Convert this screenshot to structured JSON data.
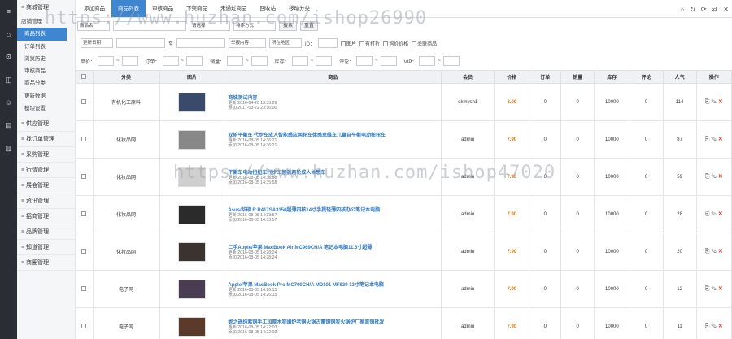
{
  "rail": [
    {
      "icon": "≡",
      "name": "menu-icon"
    },
    {
      "icon": "⌂",
      "name": "home-icon"
    },
    {
      "icon": "⚙",
      "name": "gear-icon"
    },
    {
      "icon": "◫",
      "name": "panel-icon"
    },
    {
      "icon": "☺",
      "name": "user-icon"
    },
    {
      "icon": "▤",
      "name": "list-icon"
    },
    {
      "icon": "▥",
      "name": "chart-icon"
    }
  ],
  "sidebar": {
    "top_group": "商城管理",
    "sub_top": "店铺管理",
    "items": [
      "商品列表",
      "订单列表",
      "浏览历史",
      "审核商品",
      "商品分类",
      "更新数据",
      "模块设置"
    ],
    "groups": [
      "供应管理",
      "找订单管理",
      "采购管理",
      "行情管理",
      "展会管理",
      "资讯管理",
      "招商管理",
      "品牌管理",
      "知道管理",
      "商圈管理"
    ]
  },
  "tabs": [
    "添加商品",
    "商品列表",
    "审核商品",
    "下架商品",
    "未通过商品",
    "回收站",
    "移动分类"
  ],
  "toolbar_icons": [
    "⌂",
    "↻",
    "⟳",
    "⇄",
    "✕"
  ],
  "filters": {
    "row1": {
      "sel1": "商品名",
      "sel2": "请选择",
      "sel3": "排序方式",
      "btn1": "搜索",
      "btn2": "重置"
    },
    "row2": {
      "date": "更新日期",
      "to": "至",
      "cond": "举报内容",
      "region": "所在地区",
      "id_label": "ID：",
      "checks": [
        "图片",
        "有打折",
        "询价价格",
        "关联商品"
      ]
    },
    "row3": {
      "labels": [
        "单价：",
        "订单：",
        "销量：",
        "库存：",
        "评论：",
        "VIP："
      ],
      "dash": "~"
    }
  },
  "columns": [
    "",
    "分类",
    "图片",
    "商品",
    "会员",
    "价格",
    "订单",
    "销量",
    "库存",
    "评论",
    "人气",
    "操作"
  ],
  "rows": [
    {
      "cat": "有机化工原料",
      "name": "商城测试内容",
      "updated": "更新:2016-04-20 13:33:29",
      "added": "添加:2017-03-22 23:16:00",
      "member": "qkmysh1",
      "price": "3.00",
      "orders": "0",
      "sales": "0",
      "stock": "10000",
      "comments": "0",
      "views": "114",
      "thumb": "#3a4a6a"
    },
    {
      "cat": "化妆品网",
      "name": "双轮平衡车 代步车成人智能感应两轮车体感思维车儿童自平衡电动扭扭车",
      "updated": "更新:2016-08-05 14:36:21",
      "added": "添加:2016-08-05 14:36:21",
      "member": "admin",
      "price": "7.90",
      "orders": "0",
      "sales": "0",
      "stock": "10000",
      "comments": "0",
      "views": "87",
      "thumb": "#888888"
    },
    {
      "cat": "化妆品网",
      "name": "平衡车电动扭扭车代步车智能两轮成人体感车",
      "updated": "更新:2016-08-05 14:35:58",
      "added": "添加:2016-08-05 14:35:58",
      "member": "admin",
      "price": "7.90",
      "orders": "0",
      "sales": "0",
      "stock": "10000",
      "comments": "0",
      "views": "59",
      "thumb": "#cfcfcf"
    },
    {
      "cat": "化妆品网",
      "name": "Asus/华硕 R R417SA3150超薄四核14寸手提轻薄四核办公笔记本电脑",
      "updated": "更新:2016-08-05 14:33:57",
      "added": "添加:2016-08-05 14:33:57",
      "member": "admin",
      "price": "7.90",
      "orders": "0",
      "sales": "0",
      "stock": "10000",
      "comments": "0",
      "views": "28",
      "thumb": "#2b2b2b"
    },
    {
      "cat": "化妆品网",
      "name": "二手Apple/苹果 MacBook Air MC969CH/A 笔记本电脑11.6寸超薄",
      "updated": "更新:2016-08-05 14:28:24",
      "added": "添加:2016-08-05 14:28:24",
      "member": "admin",
      "price": "7.90",
      "orders": "0",
      "sales": "0",
      "stock": "10000",
      "comments": "0",
      "views": "20",
      "thumb": "#3b3330"
    },
    {
      "cat": "电子网",
      "name": "Apple/苹果 MacBook Pro MC700CH/A MD101 MF839 13寸笔记本电脑",
      "updated": "更新:2016-08-05 14:26:15",
      "added": "添加:2016-08-05 14:26:15",
      "member": "admin",
      "price": "7.90",
      "orders": "0",
      "sales": "0",
      "stock": "10000",
      "comments": "0",
      "views": "12",
      "thumb": "#4a3c52"
    },
    {
      "cat": "电子网",
      "name": "妮之遥纯紫铜手工加厚木炭围炉老铜火锅古董铜铜炭火锅炉厂家直销批发",
      "updated": "更新:2016-08-05 14:22:03",
      "added": "添加:2016-08-05 14:22:03",
      "member": "admin",
      "price": "7.90",
      "orders": "0",
      "sales": "0",
      "stock": "10000",
      "comments": "0",
      "views": "11",
      "thumb": "#5a3a2a"
    }
  ],
  "watermarks": [
    "https://www.huzhan.com/ishop26990",
    "https://www.huzhan.com/ishop47020"
  ],
  "ops": {
    "copy": "⎘",
    "edit": "✎",
    "delete": "✕"
  }
}
